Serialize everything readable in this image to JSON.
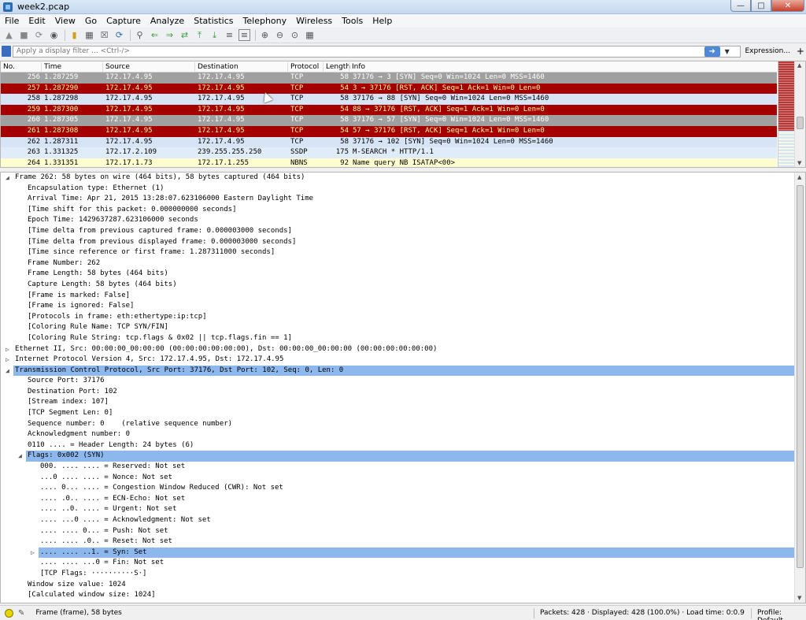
{
  "window": {
    "title": "week2.pcap"
  },
  "menu": [
    "File",
    "Edit",
    "View",
    "Go",
    "Capture",
    "Analyze",
    "Statistics",
    "Telephony",
    "Wireless",
    "Tools",
    "Help"
  ],
  "filter": {
    "placeholder": "Apply a display filter ... <Ctrl-/>",
    "expression_label": "Expression...",
    "plus_label": "+"
  },
  "packet_list": {
    "columns": [
      "No.",
      "Time",
      "Source",
      "Destination",
      "Protocol",
      "Length",
      "Info"
    ],
    "rows": [
      {
        "no": "256",
        "time": "1.287259",
        "src": "172.17.4.95",
        "dst": "172.17.4.95",
        "proto": "TCP",
        "len": "58",
        "info": "37176 → 3 [SYN] Seq=0 Win=1024 Len=0 MSS=1460",
        "style": "gray"
      },
      {
        "no": "257",
        "time": "1.287290",
        "src": "172.17.4.95",
        "dst": "172.17.4.95",
        "proto": "TCP",
        "len": "54",
        "info": "3 → 37176 [RST, ACK] Seq=1 Ack=1 Win=0 Len=0",
        "style": "red"
      },
      {
        "no": "258",
        "time": "1.287298",
        "src": "172.17.4.95",
        "dst": "172.17.4.95",
        "proto": "TCP",
        "len": "58",
        "info": "37176 → 88 [SYN] Seq=0 Win=1024 Len=0 MSS=1460",
        "style": "sel"
      },
      {
        "no": "259",
        "time": "1.287300",
        "src": "172.17.4.95",
        "dst": "172.17.4.95",
        "proto": "TCP",
        "len": "54",
        "info": "88 → 37176 [RST, ACK] Seq=1 Ack=1 Win=0 Len=0",
        "style": "red"
      },
      {
        "no": "260",
        "time": "1.287305",
        "src": "172.17.4.95",
        "dst": "172.17.4.95",
        "proto": "TCP",
        "len": "58",
        "info": "37176 → 57 [SYN] Seq=0 Win=1024 Len=0 MSS=1460",
        "style": "gray"
      },
      {
        "no": "261",
        "time": "1.287308",
        "src": "172.17.4.95",
        "dst": "172.17.4.95",
        "proto": "TCP",
        "len": "54",
        "info": "57 → 37176 [RST, ACK] Seq=1 Ack=1 Win=0 Len=0",
        "style": "red"
      },
      {
        "no": "262",
        "time": "1.287311",
        "src": "172.17.4.95",
        "dst": "172.17.4.95",
        "proto": "TCP",
        "len": "58",
        "info": "37176 → 102 [SYN] Seq=0 Win=1024 Len=0 MSS=1460",
        "style": "sel"
      },
      {
        "no": "263",
        "time": "1.331325",
        "src": "172.17.2.109",
        "dst": "239.255.255.250",
        "proto": "SSDP",
        "len": "175",
        "info": "M-SEARCH * HTTP/1.1",
        "style": "ssdp"
      },
      {
        "no": "264",
        "time": "1.331351",
        "src": "172.17.1.73",
        "dst": "172.17.1.255",
        "proto": "NBNS",
        "len": "92",
        "info": "Name query NB ISATAP<00>",
        "style": "nbns"
      }
    ]
  },
  "details": [
    {
      "lvl": 0,
      "tw": "open",
      "text": "Frame 262: 58 bytes on wire (464 bits), 58 bytes captured (464 bits)"
    },
    {
      "lvl": 1,
      "text": "Encapsulation type: Ethernet (1)"
    },
    {
      "lvl": 1,
      "text": "Arrival Time: Apr 21, 2015 13:28:07.623106000 Eastern Daylight Time"
    },
    {
      "lvl": 1,
      "text": "[Time shift for this packet: 0.000000000 seconds]"
    },
    {
      "lvl": 1,
      "text": "Epoch Time: 1429637287.623106000 seconds"
    },
    {
      "lvl": 1,
      "text": "[Time delta from previous captured frame: 0.000003000 seconds]"
    },
    {
      "lvl": 1,
      "text": "[Time delta from previous displayed frame: 0.000003000 seconds]"
    },
    {
      "lvl": 1,
      "text": "[Time since reference or first frame: 1.287311000 seconds]"
    },
    {
      "lvl": 1,
      "text": "Frame Number: 262"
    },
    {
      "lvl": 1,
      "text": "Frame Length: 58 bytes (464 bits)"
    },
    {
      "lvl": 1,
      "text": "Capture Length: 58 bytes (464 bits)"
    },
    {
      "lvl": 1,
      "text": "[Frame is marked: False]"
    },
    {
      "lvl": 1,
      "text": "[Frame is ignored: False]"
    },
    {
      "lvl": 1,
      "text": "[Protocols in frame: eth:ethertype:ip:tcp]"
    },
    {
      "lvl": 1,
      "text": "[Coloring Rule Name: TCP SYN/FIN]"
    },
    {
      "lvl": 1,
      "text": "[Coloring Rule String: tcp.flags & 0x02 || tcp.flags.fin == 1]"
    },
    {
      "lvl": 0,
      "tw": "closed",
      "text": "Ethernet II, Src: 00:00:00_00:00:00 (00:00:00:00:00:00), Dst: 00:00:00_00:00:00 (00:00:00:00:00:00)"
    },
    {
      "lvl": 0,
      "tw": "closed",
      "text": "Internet Protocol Version 4, Src: 172.17.4.95, Dst: 172.17.4.95"
    },
    {
      "lvl": 0,
      "tw": "open",
      "text": "Transmission Control Protocol, Src Port: 37176, Dst Port: 102, Seq: 0, Len: 0",
      "hl": true
    },
    {
      "lvl": 1,
      "text": "Source Port: 37176"
    },
    {
      "lvl": 1,
      "text": "Destination Port: 102"
    },
    {
      "lvl": 1,
      "text": "[Stream index: 107]"
    },
    {
      "lvl": 1,
      "text": "[TCP Segment Len: 0]"
    },
    {
      "lvl": 1,
      "text": "Sequence number: 0    (relative sequence number)"
    },
    {
      "lvl": 1,
      "text": "Acknowledgment number: 0"
    },
    {
      "lvl": 1,
      "text": "0110 .... = Header Length: 24 bytes (6)"
    },
    {
      "lvl": 1,
      "tw": "open",
      "text": "Flags: 0x002 (SYN)",
      "hl": true
    },
    {
      "lvl": 2,
      "text": "000. .... .... = Reserved: Not set"
    },
    {
      "lvl": 2,
      "text": "...0 .... .... = Nonce: Not set"
    },
    {
      "lvl": 2,
      "text": ".... 0... .... = Congestion Window Reduced (CWR): Not set"
    },
    {
      "lvl": 2,
      "text": ".... .0.. .... = ECN-Echo: Not set"
    },
    {
      "lvl": 2,
      "text": ".... ..0. .... = Urgent: Not set"
    },
    {
      "lvl": 2,
      "text": ".... ...0 .... = Acknowledgment: Not set"
    },
    {
      "lvl": 2,
      "text": ".... .... 0... = Push: Not set"
    },
    {
      "lvl": 2,
      "text": ".... .... .0.. = Reset: Not set"
    },
    {
      "lvl": 2,
      "tw": "closed",
      "text": ".... .... ..1. = Syn: Set",
      "hl": true
    },
    {
      "lvl": 2,
      "text": ".... .... ...0 = Fin: Not set"
    },
    {
      "lvl": 2,
      "text": "[TCP Flags: ··········S·]"
    },
    {
      "lvl": 1,
      "text": "Window size value: 1024"
    },
    {
      "lvl": 1,
      "text": "[Calculated window size: 1024]"
    }
  ],
  "status": {
    "frame_text": "Frame (frame), 58 bytes",
    "packets_text": "Packets: 428 · Displayed: 428 (100.0%) · Load time: 0:0.9",
    "profile_text": "Profile: Default"
  },
  "icons": {
    "window_controls": [
      "minimize-icon",
      "maximize-icon",
      "close-icon"
    ]
  }
}
